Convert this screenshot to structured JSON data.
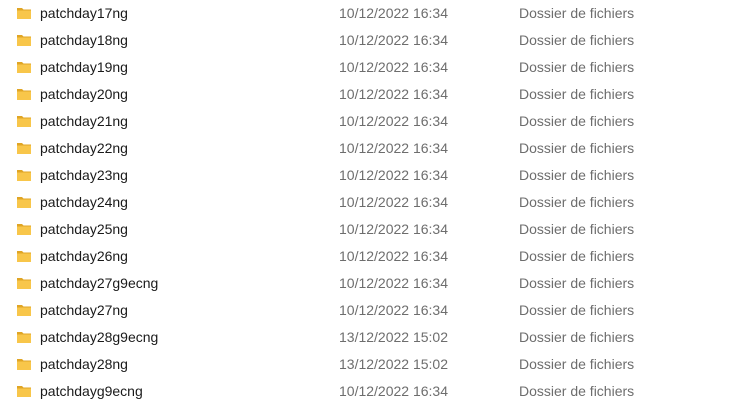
{
  "files": [
    {
      "name": "patchday17ng",
      "date": "10/12/2022 16:34",
      "type": "Dossier de fichiers",
      "icon": "folder-icon"
    },
    {
      "name": "patchday18ng",
      "date": "10/12/2022 16:34",
      "type": "Dossier de fichiers",
      "icon": "folder-icon"
    },
    {
      "name": "patchday19ng",
      "date": "10/12/2022 16:34",
      "type": "Dossier de fichiers",
      "icon": "folder-icon"
    },
    {
      "name": "patchday20ng",
      "date": "10/12/2022 16:34",
      "type": "Dossier de fichiers",
      "icon": "folder-icon"
    },
    {
      "name": "patchday21ng",
      "date": "10/12/2022 16:34",
      "type": "Dossier de fichiers",
      "icon": "folder-icon"
    },
    {
      "name": "patchday22ng",
      "date": "10/12/2022 16:34",
      "type": "Dossier de fichiers",
      "icon": "folder-icon"
    },
    {
      "name": "patchday23ng",
      "date": "10/12/2022 16:34",
      "type": "Dossier de fichiers",
      "icon": "folder-icon"
    },
    {
      "name": "patchday24ng",
      "date": "10/12/2022 16:34",
      "type": "Dossier de fichiers",
      "icon": "folder-icon"
    },
    {
      "name": "patchday25ng",
      "date": "10/12/2022 16:34",
      "type": "Dossier de fichiers",
      "icon": "folder-icon"
    },
    {
      "name": "patchday26ng",
      "date": "10/12/2022 16:34",
      "type": "Dossier de fichiers",
      "icon": "folder-icon"
    },
    {
      "name": "patchday27g9ecng",
      "date": "10/12/2022 16:34",
      "type": "Dossier de fichiers",
      "icon": "folder-icon"
    },
    {
      "name": "patchday27ng",
      "date": "10/12/2022 16:34",
      "type": "Dossier de fichiers",
      "icon": "folder-icon"
    },
    {
      "name": "patchday28g9ecng",
      "date": "13/12/2022 15:02",
      "type": "Dossier de fichiers",
      "icon": "folder-icon"
    },
    {
      "name": "patchday28ng",
      "date": "13/12/2022 15:02",
      "type": "Dossier de fichiers",
      "icon": "folder-icon"
    },
    {
      "name": "patchdayg9ecng",
      "date": "10/12/2022 16:34",
      "type": "Dossier de fichiers",
      "icon": "folder-icon"
    }
  ],
  "colors": {
    "folder_body": "#f8c64a",
    "folder_back": "#e0a525",
    "name_text": "#1a1a1a",
    "meta_text": "#6d6d6d",
    "background": "#ffffff"
  }
}
